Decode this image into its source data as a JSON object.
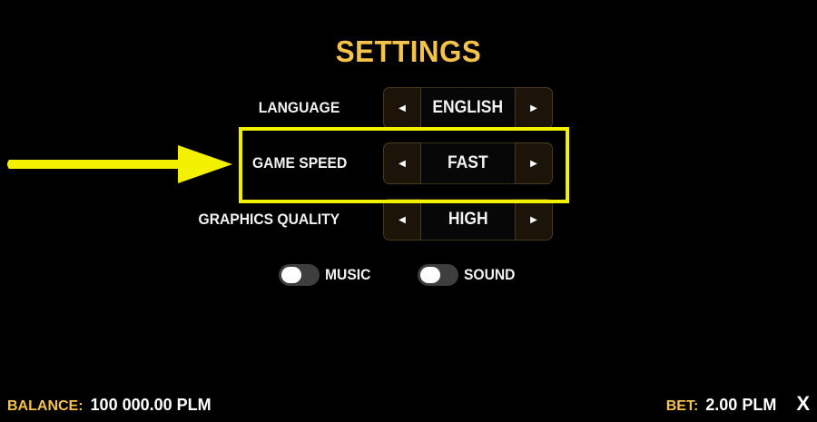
{
  "title": "SETTINGS",
  "settings": [
    {
      "label": "LANGUAGE",
      "value": "ENGLISH",
      "prev_icon": "triangle-left-icon",
      "next_icon": "triangle-right-icon"
    },
    {
      "label": "GAME SPEED",
      "value": "FAST",
      "prev_icon": "triangle-left-icon",
      "next_icon": "triangle-right-icon"
    },
    {
      "label": "GRAPHICS QUALITY",
      "value": "HIGH",
      "prev_icon": "triangle-left-icon",
      "next_icon": "triangle-right-icon"
    }
  ],
  "toggles": {
    "music": {
      "label": "MUSIC",
      "state": "off"
    },
    "sound": {
      "label": "SOUND",
      "state": "off"
    }
  },
  "footer": {
    "balance_label": "BALANCE:",
    "balance_value": "100 000.00 PLM",
    "bet_label": "BET:",
    "bet_value": "2.00 PLM",
    "close_symbol": "X"
  },
  "colors": {
    "accent": "#f5c24a",
    "highlight": "#f4f100",
    "background": "#000000"
  }
}
